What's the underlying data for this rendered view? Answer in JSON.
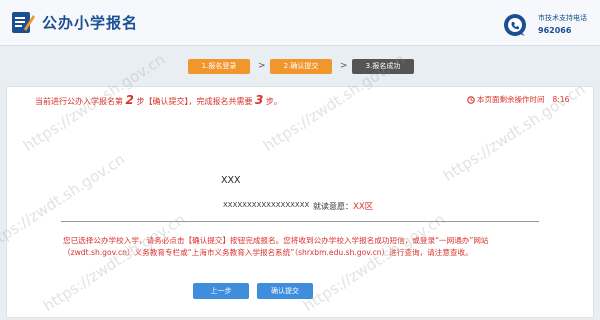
{
  "header": {
    "title": "公办小学报名",
    "logo_icon": "edit-form-icon",
    "hotline_label": "市技术支持电话",
    "hotline_number": "962066",
    "hotline_icon": "phone-chat-icon"
  },
  "steps": [
    {
      "label": "1.报名登录",
      "state": "done"
    },
    {
      "label": "2.确认提交",
      "state": "current"
    },
    {
      "label": "3.报名成功",
      "state": "todo"
    }
  ],
  "step_arrow": ">",
  "progress": {
    "prefix": "当前进行公办入学报名第",
    "current_step": "2",
    "middle": "步【确认提交】，完成报名共需要",
    "total_steps": "3",
    "suffix": "步。"
  },
  "timer": {
    "label": "本页面剩余操作时间",
    "value": "8:16",
    "icon": "clock-icon"
  },
  "child": {
    "name": "XXX",
    "id_number": "XXXXXXXXXXXXXXXXXX",
    "intention_label": "就读意愿：",
    "intention_value": "XX区"
  },
  "notice": "您已选择公办学校入学，请务必点击【确认提交】按钮完成报名。您将收到公办学校入学报名成功短信，或登录“一网通办”网站（zwdt.sh.gov.cn）义务教育专栏或“上海市义务教育入学报名系统”（shrxbm.edu.sh.gov.cn）进行查询，请注意查收。",
  "buttons": {
    "prev": "上一步",
    "confirm": "确认提交"
  },
  "watermark": "https://zwdt.sh.gov.cn",
  "colors": {
    "brand_blue": "#1a4f94",
    "step_orange": "#f0962c",
    "step_gray": "#555555",
    "alert_red": "#d9312b",
    "button_blue": "#3f8ddc"
  }
}
